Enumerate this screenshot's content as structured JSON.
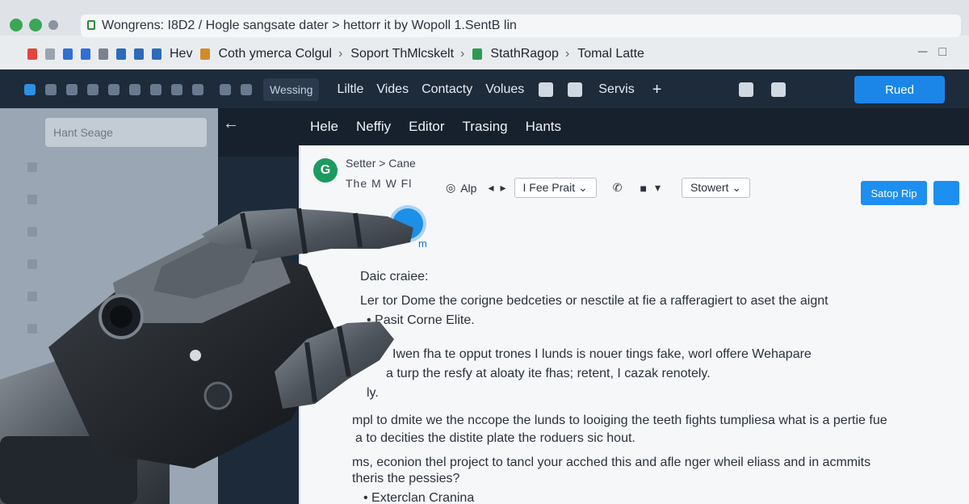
{
  "browser": {
    "address_text": "Wongrens: I8D2 / Hogle sangsate dater > hettorr it by Wopoll 1.SentB lin",
    "bookmarks": [
      "Hev",
      "Coth ymerca Colgul",
      "Soport ThMlcskelt",
      "StathRagop",
      "Tomal Latte"
    ]
  },
  "toolbar": {
    "pill_label": "Wessing",
    "links": [
      "Liltle",
      "Vides",
      "Contacty",
      "Volues",
      "Servis"
    ],
    "new_button_label": "Rued"
  },
  "sidebar": {
    "search_placeholder": "Hant Seage"
  },
  "editor": {
    "tabs": [
      "Hele",
      "Neffiy",
      "Editor",
      "Trasing",
      "Hants"
    ],
    "breadcrumb": "Setter  >   Cane",
    "format_row": "The    M    W    Fl",
    "align_label": "Alp",
    "font_select": "I Fee Prait",
    "style_select": "Stowert",
    "save_label": "Satop Rip",
    "cursor_label": "m"
  },
  "document": {
    "heading": "Daic craiee:",
    "lines": [
      "Ler tor Dome the corigne bedceties or nesctile at fie a rafferagiert to aset the aignt",
      "• Pasit Corne Elite.",
      "Iwen fha te opput trones I lunds is nouer tings fake, worl offere Wehapare",
      "a turp the resfy at aloaty ite fhas; retent, I cazak renotely.",
      "ly.",
      "mpl to dmite we the nccope the lunds to looiging the teeth fights tumpliesa what is a pertie fue",
      "a to decities the distite plate the roduers sic hout.",
      "ms, econion thel project to tancl your acched this and afle nger wheil eliass and in acmmits",
      "theris the pessies?",
      "• Exterclan Cranina"
    ]
  }
}
